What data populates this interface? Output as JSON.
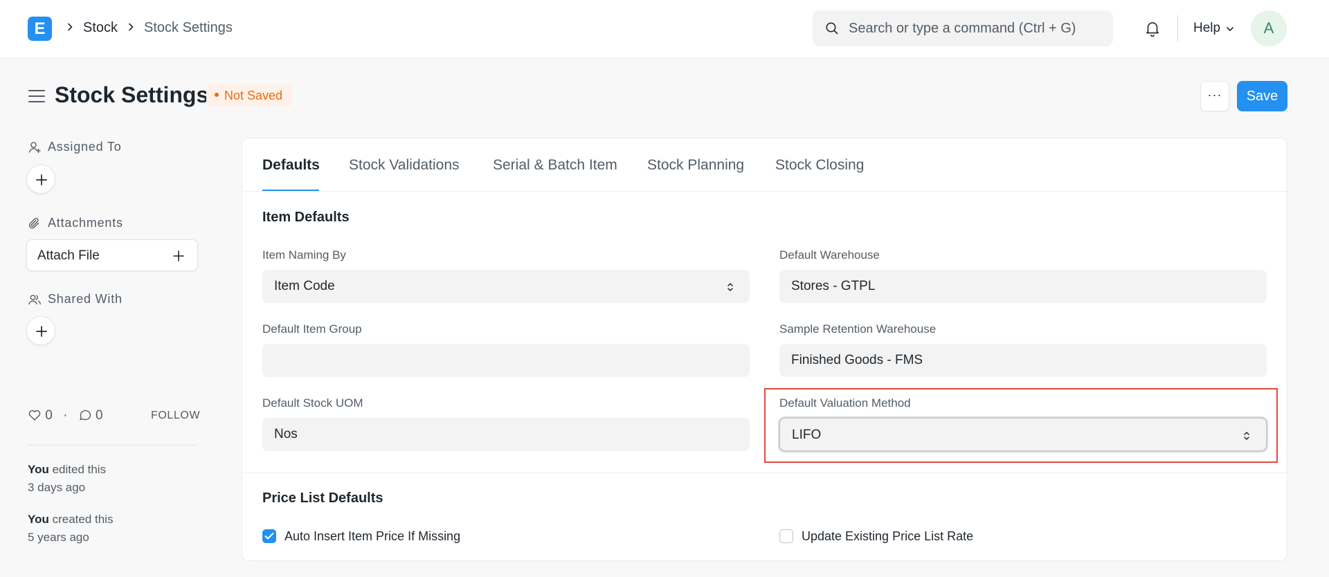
{
  "navbar": {
    "logo_letter": "E",
    "breadcrumbs": [
      "Stock",
      "Stock Settings"
    ],
    "search_placeholder": "Search or type a command (Ctrl + G)",
    "help_label": "Help",
    "avatar_initial": "A"
  },
  "page": {
    "title": "Stock Settings",
    "status": "Not Saved",
    "more_label": "···",
    "save_label": "Save"
  },
  "sidebar": {
    "assigned_to": "Assigned To",
    "attachments": "Attachments",
    "attach_file": "Attach File",
    "shared_with": "Shared With",
    "likes_count": "0",
    "comments_count": "0",
    "separator": "·",
    "follow_label": "FOLLOW",
    "activity": [
      {
        "who": "You",
        "action": " edited this",
        "when": "3 days ago"
      },
      {
        "who": "You",
        "action": " created this",
        "when": "5 years ago"
      }
    ]
  },
  "tabs": [
    "Defaults",
    "Stock Validations",
    "Serial & Batch Item",
    "Stock Planning",
    "Stock Closing"
  ],
  "active_tab": "Defaults",
  "item_defaults": {
    "title": "Item Defaults",
    "fields": [
      {
        "label": "Item Naming By",
        "value": "Item Code",
        "type": "select"
      },
      {
        "label": "Default Warehouse",
        "value": "Stores - GTPL",
        "type": "link"
      },
      {
        "label": "Default Item Group",
        "value": "",
        "type": "link"
      },
      {
        "label": "Sample Retention Warehouse",
        "value": "Finished Goods - FMS",
        "type": "link"
      },
      {
        "label": "Default Stock UOM",
        "value": "Nos",
        "type": "link"
      },
      {
        "label": "Default Valuation Method",
        "value": "LIFO",
        "type": "select"
      }
    ]
  },
  "price_list_defaults": {
    "title": "Price List Defaults",
    "checkboxes": [
      {
        "label": "Auto Insert Item Price If Missing",
        "checked": true
      },
      {
        "label": "Update Existing Price List Rate",
        "checked": false
      }
    ]
  },
  "colors": {
    "primary": "#2490ef",
    "status_orange": "#e86c13",
    "highlight_red": "#e04a3b"
  }
}
